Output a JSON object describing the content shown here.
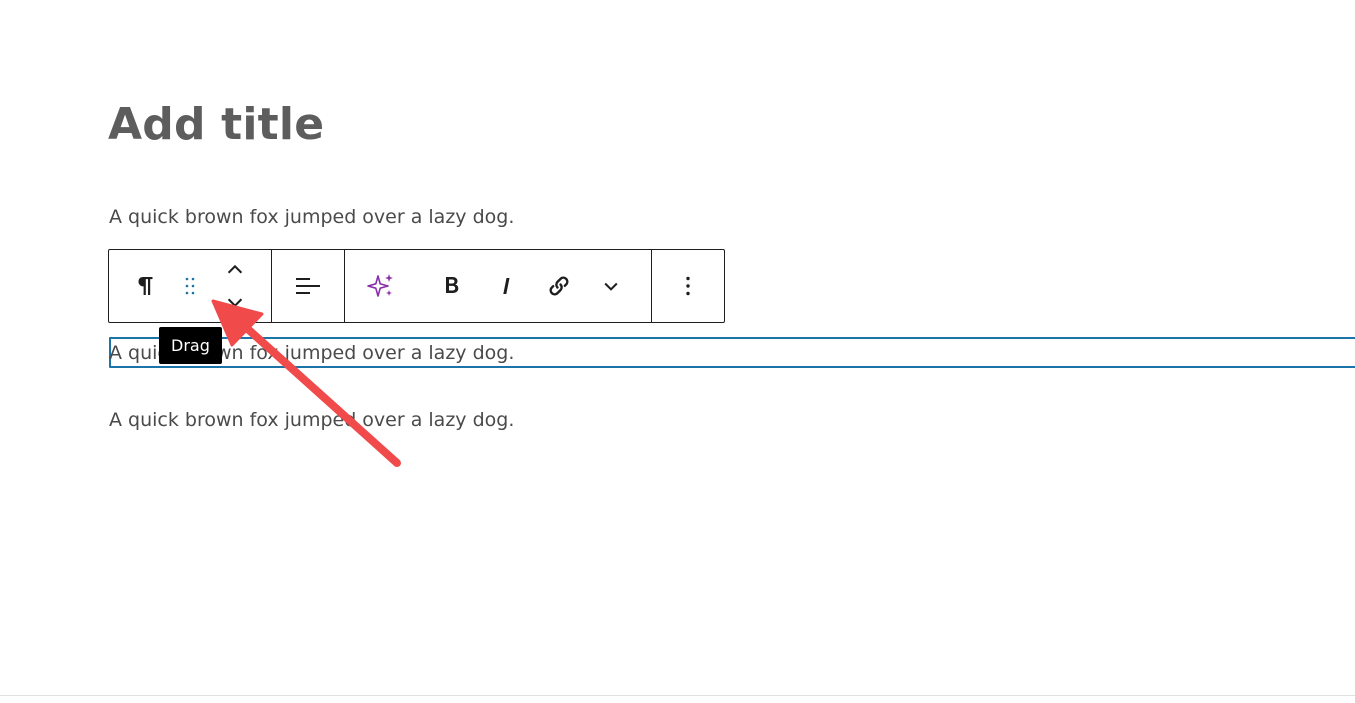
{
  "editor": {
    "title_placeholder": "Add title",
    "paragraphs": [
      "A quick brown fox jumped over a lazy dog.",
      "A quick brown fox jumped over a lazy dog.",
      "A quick brown fox jumped over a lazy dog."
    ]
  },
  "toolbar": {
    "buttons": [
      {
        "name": "paragraph-block-type",
        "icon": "pilcrow-icon"
      },
      {
        "name": "drag-handle",
        "icon": "drag-dots-icon"
      },
      {
        "name": "move-up",
        "icon": "chevron-up-icon"
      },
      {
        "name": "move-down",
        "icon": "chevron-down-icon"
      },
      {
        "name": "align",
        "icon": "align-left-icon"
      },
      {
        "name": "ai-assistant",
        "icon": "sparkle-icon"
      },
      {
        "name": "bold",
        "icon": "bold-icon"
      },
      {
        "name": "italic",
        "icon": "italic-icon"
      },
      {
        "name": "link",
        "icon": "link-icon"
      },
      {
        "name": "more-rich-text",
        "icon": "chevron-down-icon"
      },
      {
        "name": "options",
        "icon": "more-vertical-icon"
      }
    ]
  },
  "tooltip": {
    "text": "Drag"
  },
  "colors": {
    "accent": "#1b74a8",
    "ai_purple": "#8a2ea8",
    "annotation_arrow": "#f04a4a",
    "title_text": "#5d5d5d",
    "body_text": "#4a4a4a"
  }
}
